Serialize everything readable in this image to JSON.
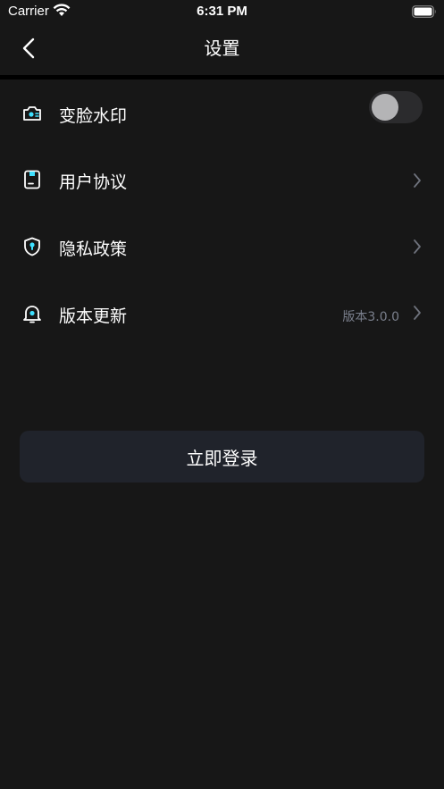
{
  "status_bar": {
    "carrier": "Carrier",
    "time": "6:31 PM",
    "wifi_icon": "wifi-icon",
    "battery_icon": "battery-icon"
  },
  "nav": {
    "title": "设置",
    "back_icon": "chevron-left-icon"
  },
  "settings": {
    "items": [
      {
        "label": "变脸水印",
        "icon": "camera-face-icon",
        "control": "toggle",
        "toggle_on": false
      },
      {
        "label": "用户协议",
        "icon": "document-icon",
        "control": "chevron"
      },
      {
        "label": "隐私政策",
        "icon": "shield-icon",
        "control": "chevron"
      },
      {
        "label": "版本更新",
        "icon": "bell-icon",
        "control": "chevron",
        "value": "版本3.0.0"
      }
    ]
  },
  "login": {
    "label": "立即登录"
  },
  "colors": {
    "background": "#171717",
    "accent": "#3ee0ff",
    "button_bg": "#20232b",
    "secondary_text": "#7a7f8c"
  }
}
